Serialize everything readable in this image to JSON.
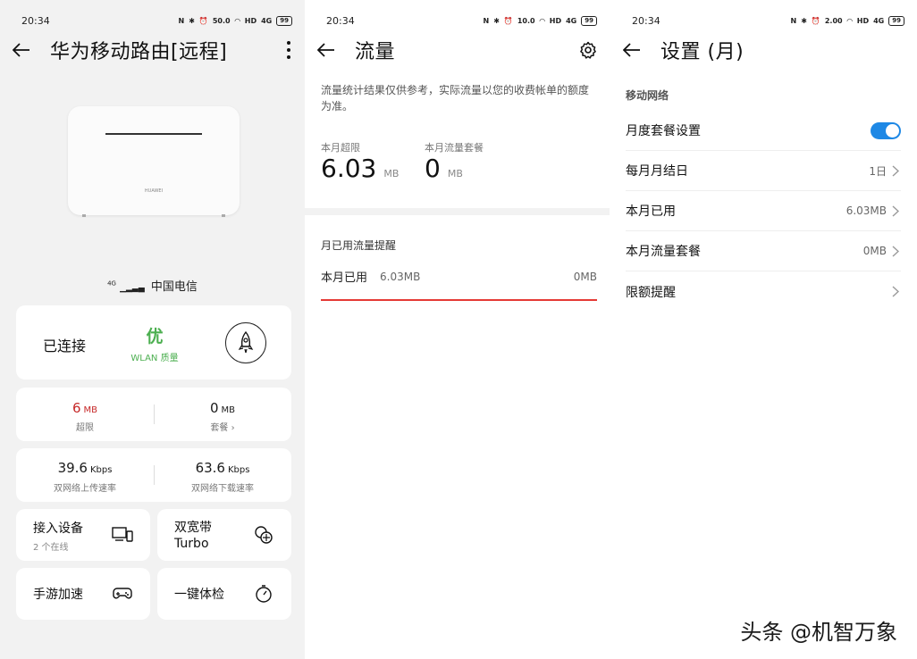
{
  "colors": {
    "accent": "#1e88e5",
    "good": "#4caf50",
    "alert": "#c62828",
    "bar": "#e53935"
  },
  "status_bar": {
    "time": "20:34",
    "icons": [
      "nfc-icon",
      "bluetooth-icon",
      "alarm-icon",
      "wifi-icon",
      "hd-icon",
      "signal-icon",
      "battery-icon"
    ],
    "speed_1": "50.0",
    "speed_2": "10.0",
    "speed_3": "2.00",
    "speed_unit": "KB/S",
    "hd": "HD",
    "network": "4G",
    "battery": "99"
  },
  "router_panel": {
    "title": "华为移动路由[远程]",
    "router_brand": "HUAWEI",
    "carrier_network": "4G",
    "carrier": "中国电信",
    "connection": {
      "status": "已连接",
      "quality": "优",
      "quality_label": "WLAN 质量"
    },
    "data": {
      "over_value": "6",
      "over_unit": "MB",
      "over_label": "超限",
      "plan_value": "0",
      "plan_unit": "MB",
      "plan_label": "套餐"
    },
    "speed": {
      "up_value": "39.6",
      "up_unit": "Kbps",
      "up_label": "双网络上传速率",
      "down_value": "63.6",
      "down_unit": "Kbps",
      "down_label": "双网络下载速率"
    },
    "tiles": {
      "devices_title": "接入设备",
      "devices_sub": "2 个在线",
      "turbo_title_1": "双宽带",
      "turbo_title_2": "Turbo",
      "game_title": "手游加速",
      "check_title": "一键体检"
    }
  },
  "traffic_panel": {
    "title": "流量",
    "note": "流量统计结果仅供参考，实际流量以您的收费帐单的额度为准。",
    "over_label": "本月超限",
    "over_value": "6.03",
    "over_unit": "MB",
    "plan_label": "本月流量套餐",
    "plan_value": "0",
    "plan_unit": "MB",
    "reminder_section": "月已用流量提醒",
    "used_label": "本月已用",
    "used_value": "6.03MB",
    "limit_value": "0MB",
    "progress": 1.0
  },
  "settings_panel": {
    "title": "设置 (月)",
    "group": "移动网络",
    "rows": [
      {
        "label": "月度套餐设置",
        "toggle_on": true
      },
      {
        "label": "每月月结日",
        "value": "1日"
      },
      {
        "label": "本月已用",
        "value": "6.03MB"
      },
      {
        "label": "本月流量套餐",
        "value": "0MB"
      },
      {
        "label": "限额提醒",
        "value": ""
      }
    ]
  },
  "watermark": "头条 @机智万象"
}
